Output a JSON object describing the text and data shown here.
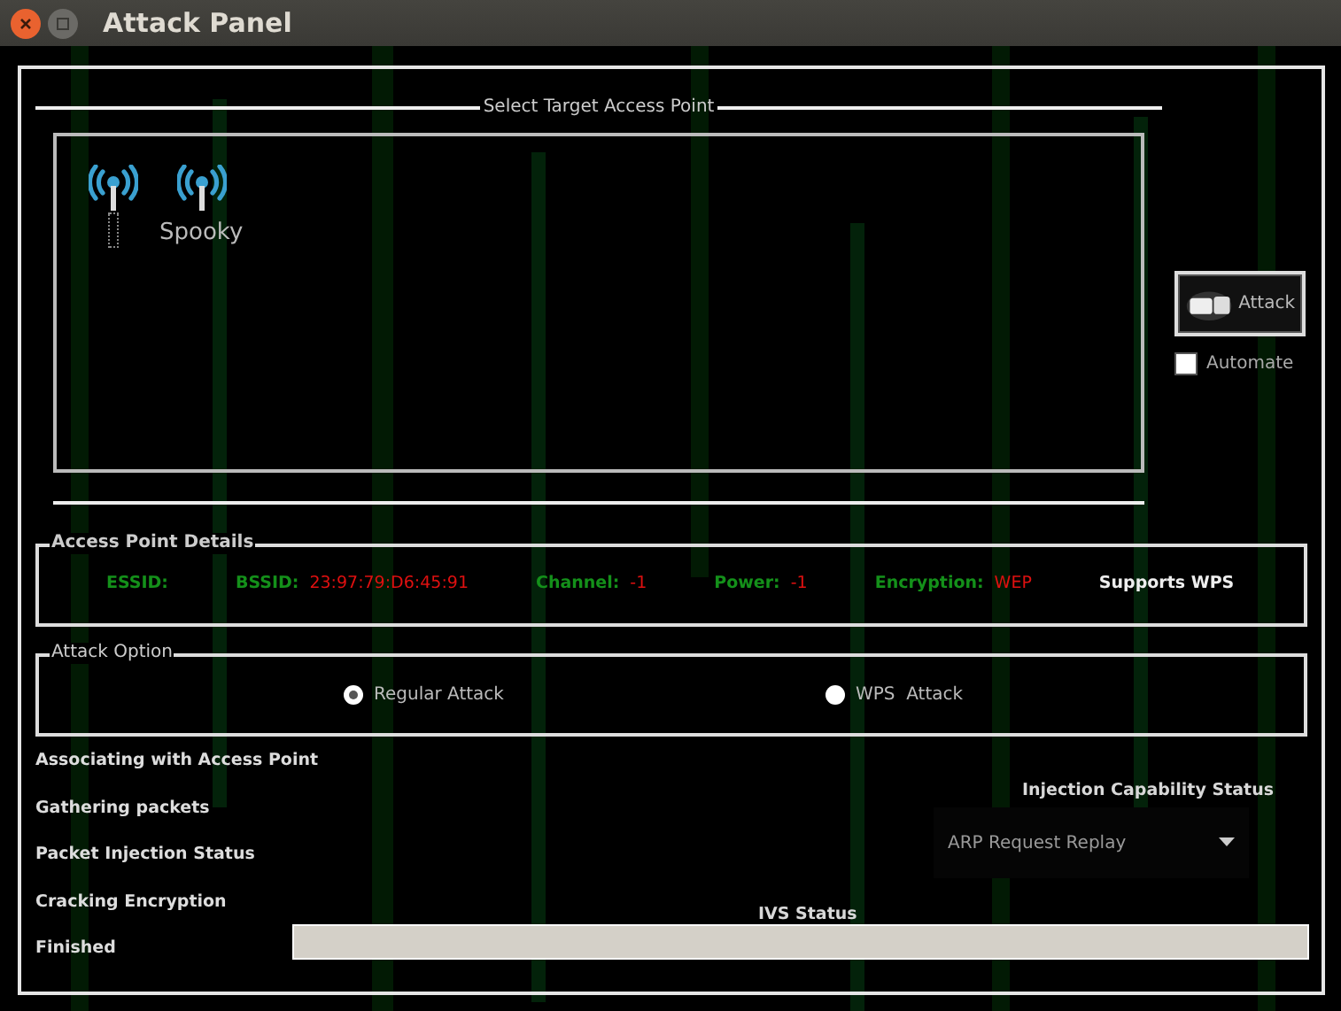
{
  "window": {
    "title": "Attack Panel"
  },
  "target_section": {
    "title": "Select Target Access Point",
    "access_points": [
      {
        "focused": true,
        "selected": false
      },
      {
        "name": "Spooky",
        "focused": false,
        "selected": false
      }
    ]
  },
  "attack_button": {
    "label": "Attack"
  },
  "automate": {
    "label": "Automate",
    "checked": false
  },
  "details": {
    "title": "Access Point Details",
    "fields": [
      {
        "label": "ESSID:"
      },
      {
        "label": "BSSID:",
        "value": "23:97:79:D6:45:91"
      },
      {
        "label": "Channel:",
        "value": "-1"
      },
      {
        "label": "Power:",
        "value": "-1"
      },
      {
        "label": "Encryption:",
        "value": "WEP"
      }
    ],
    "wps_note": "Supports WPS"
  },
  "attack_option": {
    "title": "Attack Option",
    "options": [
      {
        "label": "Regular Attack",
        "selected": true
      },
      {
        "label": "WPS  Attack",
        "selected": false
      }
    ]
  },
  "steps": [
    "Associating with Access Point",
    "Gathering packets",
    "Packet Injection Status",
    "Cracking Encryption",
    "Finished"
  ],
  "injection": {
    "title": "Injection Capability Status",
    "dropdown": "ARP Request Replay"
  },
  "ivs": {
    "title": "IVS Status",
    "level": 0
  }
}
